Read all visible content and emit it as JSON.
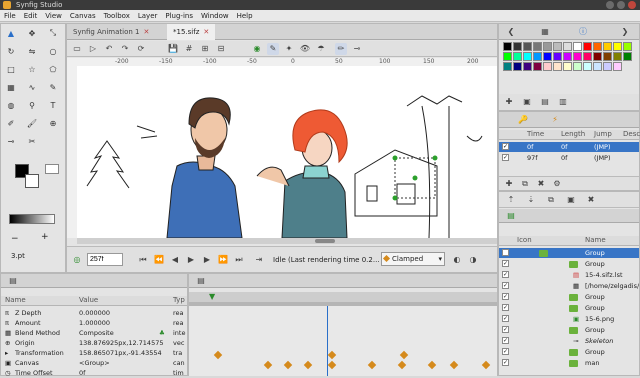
{
  "title_bar": {
    "title": "Synfig Studio"
  },
  "menu": [
    "File",
    "Edit",
    "View",
    "Canvas",
    "Toolbox",
    "Layer",
    "Plug-ins",
    "Window",
    "Help"
  ],
  "tabs": {
    "tab1": "Synfig Animation 1",
    "tab2": "*15.sifz"
  },
  "ruler": {
    "labels": [
      "-200",
      "-150",
      "-100",
      "-50",
      "0",
      "50",
      "100",
      "150",
      "200"
    ]
  },
  "frame_field": "257f",
  "status": "Idle (Last rendering time 0.2...",
  "interpolation": "Clamped",
  "brush_size": "3.pt",
  "params": {
    "headers": [
      "Name",
      "Value",
      "Typ"
    ],
    "rows": [
      {
        "name": "Z Depth",
        "value": "0.000000",
        "type": "rea"
      },
      {
        "name": "Amount",
        "value": "1.000000",
        "type": "rea"
      },
      {
        "name": "Blend Method",
        "value": "Composite",
        "type": "inte"
      },
      {
        "name": "Origin",
        "value": "138.876925px,12.714575",
        "type": "vec"
      },
      {
        "name": "Transformation",
        "value": "158.865071px,-91.43554",
        "type": "tra"
      },
      {
        "name": "Canvas",
        "value": "<Group>",
        "type": "can"
      },
      {
        "name": "Time Offset",
        "value": "0f",
        "type": "tim"
      }
    ]
  },
  "waypoints": {
    "headers": [
      "Time",
      "Length",
      "Jump",
      "Desc"
    ],
    "rows": [
      {
        "time": "0f",
        "length": "0f",
        "jump": "(JMP)"
      },
      {
        "time": "97f",
        "length": "0f",
        "jump": "(JMP)"
      }
    ]
  },
  "layers": {
    "headers": [
      "Icon",
      "Name"
    ],
    "rows": [
      "Group",
      "Group",
      "15-4.sifz.lst",
      "[/home/zelgadis/...",
      "Group",
      "Group",
      "15-6.png",
      "Group",
      "Skeleton",
      "Group",
      "man"
    ]
  },
  "palette_colors": [
    "#000000",
    "#333333",
    "#555555",
    "#777777",
    "#999999",
    "#bbbbbb",
    "#dddddd",
    "#ffffff",
    "#ff0000",
    "#ff6600",
    "#ffcc00",
    "#ffff00",
    "#99ff00",
    "#00ff00",
    "#00ff99",
    "#00ffff",
    "#0099ff",
    "#0000ff",
    "#6600ff",
    "#cc00ff",
    "#ff00cc",
    "#ff0066",
    "#800000",
    "#804000",
    "#808000",
    "#008000",
    "#008080",
    "#000080",
    "#400080",
    "#800040",
    "#ffcccc",
    "#ffe5cc",
    "#ffffcc",
    "#ccffcc",
    "#ccffff",
    "#cce5ff",
    "#ccccff",
    "#ffccff"
  ]
}
